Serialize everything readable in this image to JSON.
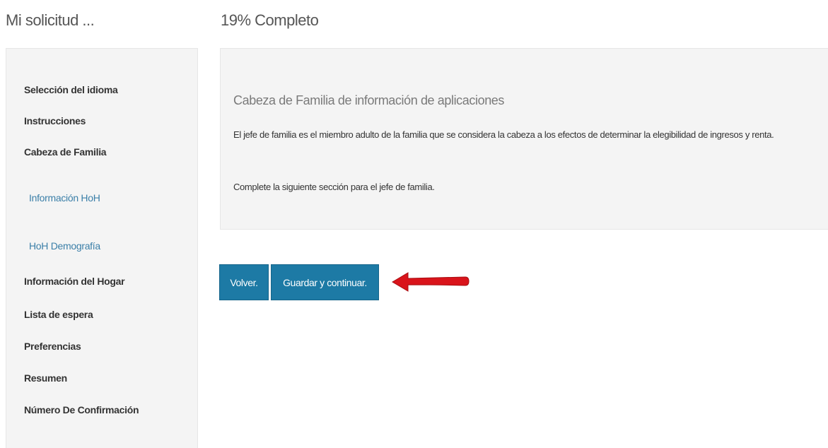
{
  "header": {
    "app_title": "Mi solicitud ...",
    "progress_text": "19% Completo"
  },
  "sidebar": {
    "items": [
      {
        "label": "Selección del idioma",
        "level": 0
      },
      {
        "label": "Instrucciones",
        "level": 0
      },
      {
        "label": "Cabeza de Familia",
        "level": 0
      },
      {
        "label": "Información HoH",
        "level": 1
      },
      {
        "label": "HoH Demografía",
        "level": 1
      },
      {
        "label": "Información del Hogar",
        "level": 0
      },
      {
        "label": "Lista de espera",
        "level": 0
      },
      {
        "label": "Preferencias",
        "level": 0
      },
      {
        "label": "Resumen",
        "level": 0
      },
      {
        "label": "Número De Confirmación",
        "level": 0
      }
    ]
  },
  "main": {
    "heading": "Cabeza de Familia de información de aplicaciones",
    "description": "El jefe de familia es el miembro adulto de la familia que se considera la cabeza a los efectos de determinar la elegibilidad de ingresos y renta.",
    "instruction": "Complete la siguiente sección para el jefe de familia."
  },
  "buttons": {
    "back_label": "Volver.",
    "save_label": "Guardar y continuar."
  },
  "colors": {
    "button": "#1d7aa5",
    "sub_link": "#3b7fa8",
    "annotation_arrow": "#d9141b"
  },
  "annotation": {
    "arrow_icon": "red-arrow-left-icon"
  }
}
